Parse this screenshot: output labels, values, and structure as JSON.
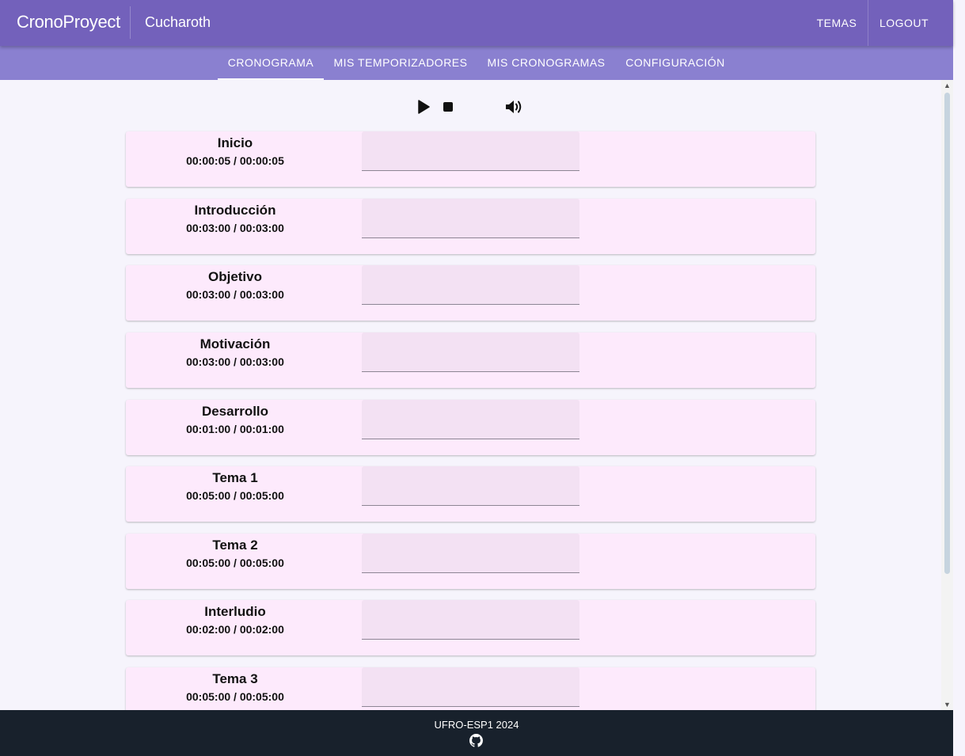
{
  "header": {
    "brand": "CronoProyect",
    "user": "Cucharoth",
    "buttons": {
      "temas": "TEMAS",
      "logout": "LOGOUT"
    }
  },
  "tabs": [
    {
      "label": "CRONOGRAMA",
      "active": true
    },
    {
      "label": "MIS TEMPORIZADORES",
      "active": false
    },
    {
      "label": "MIS CRONOGRAMAS",
      "active": false
    },
    {
      "label": "CONFIGURACIÓN",
      "active": false
    }
  ],
  "controls": {
    "icons": [
      "play-icon",
      "stop-icon",
      "volume-icon"
    ]
  },
  "segments": [
    {
      "name": "Inicio",
      "time": "00:00:05 / 00:00:05"
    },
    {
      "name": "Introducción",
      "time": "00:03:00 / 00:03:00"
    },
    {
      "name": "Objetivo",
      "time": "00:03:00 / 00:03:00"
    },
    {
      "name": "Motivación",
      "time": "00:03:00 / 00:03:00"
    },
    {
      "name": "Desarrollo",
      "time": "00:01:00 / 00:01:00"
    },
    {
      "name": "Tema 1",
      "time": "00:05:00 / 00:05:00"
    },
    {
      "name": "Tema 2",
      "time": "00:05:00 / 00:05:00"
    },
    {
      "name": "Interludio",
      "time": "00:02:00 / 00:02:00"
    },
    {
      "name": "Tema 3",
      "time": "00:05:00 / 00:05:00"
    }
  ],
  "footer": {
    "text": "UFRO-ESP1 2024",
    "icon": "github-icon"
  },
  "colors": {
    "header": "#7361bb",
    "tabbar": "#8a80d0",
    "card": "#fdeafc",
    "field": "#f3e1f3",
    "footer": "#18212c"
  }
}
